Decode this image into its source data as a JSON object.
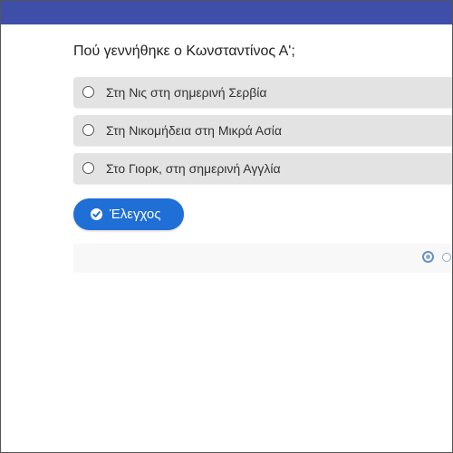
{
  "colors": {
    "topbar": "#3f4ea8",
    "option_bg": "#e3e3e3",
    "button_bg": "#1f6fd6",
    "button_text": "#ffffff",
    "pager_accent": "#6a8ec6"
  },
  "quiz": {
    "question": "Πού γεννήθηκε ο Κωνσταντίνος Α';",
    "options": [
      {
        "label": "Στη Νις στη σημερινή Σερβία"
      },
      {
        "label": "Στη Νικομήδεια στη Μικρά Ασία"
      },
      {
        "label": "Στο Γιορκ, στη σημερινή Αγγλία"
      }
    ],
    "check_button": {
      "label": "Έλεγχος",
      "icon": "check-circle-icon"
    },
    "pager": {
      "current": 1
    }
  }
}
